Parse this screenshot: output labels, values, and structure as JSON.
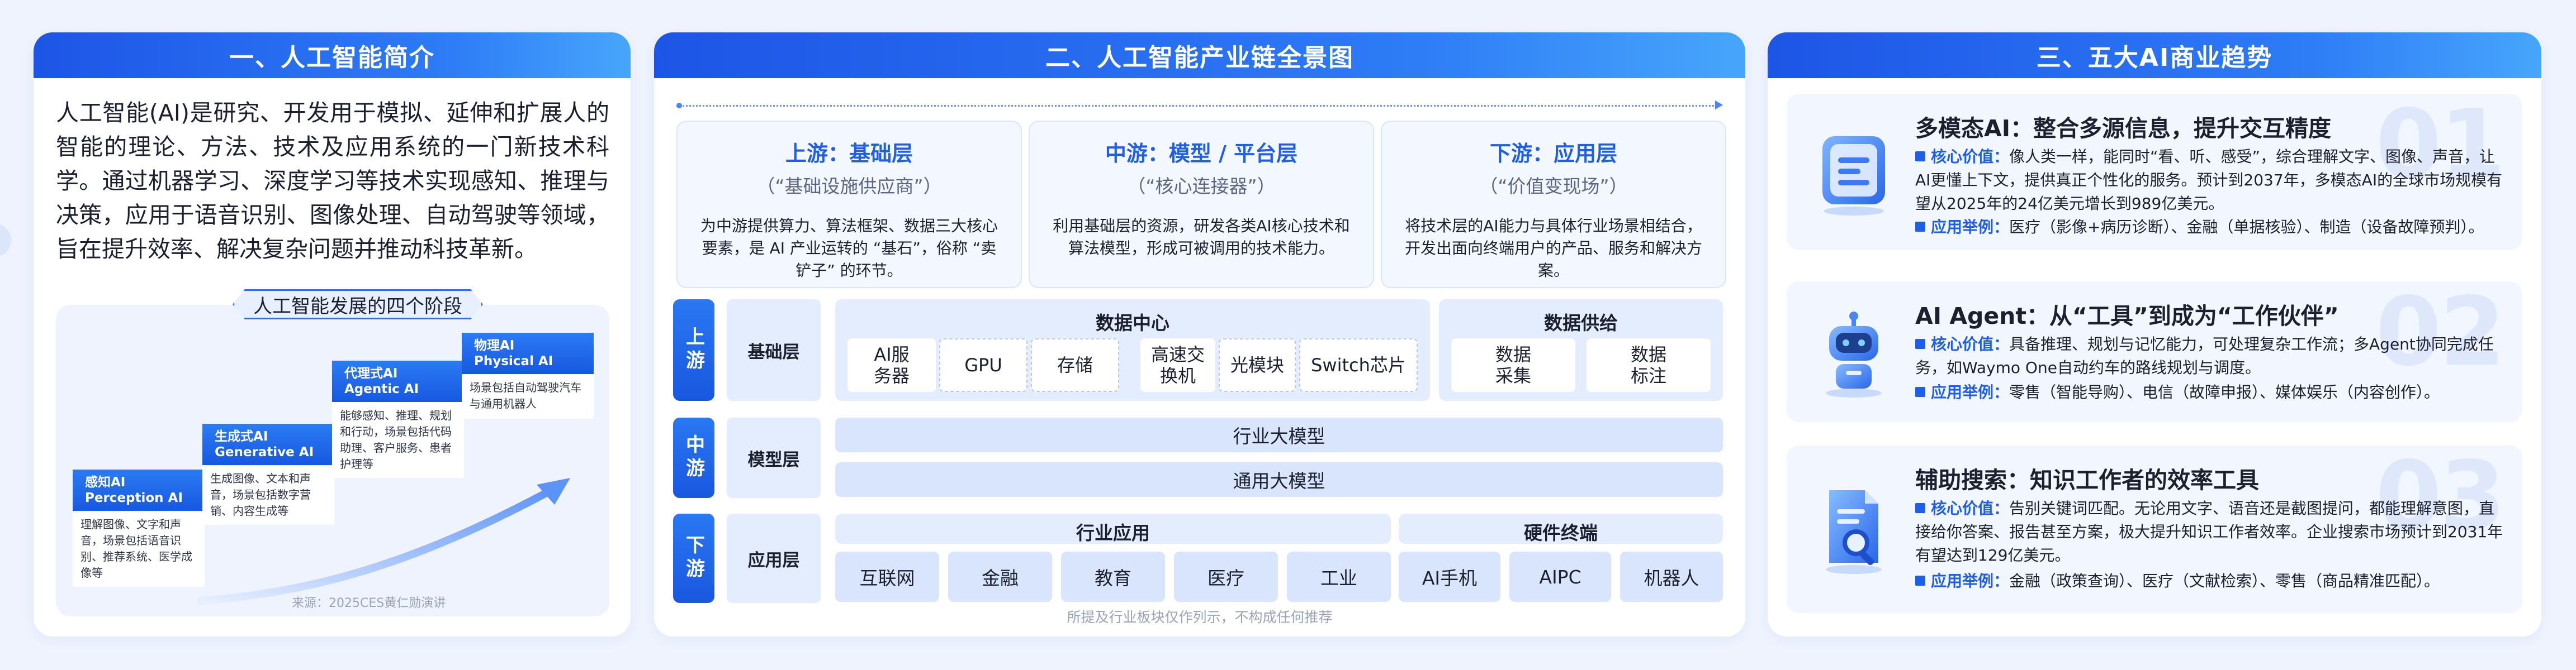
{
  "panel1": {
    "title": "一、人工智能简介",
    "intro": "人工智能(AI)是研究、开发用于模拟、延伸和扩展人的智能的理论、方法、技术及应用系统的一门新技术科学。通过机器学习、深度学习等技术实现感知、推理与决策，应用于语音识别、图像处理、自动驾驶等领域，旨在提升效率、解决复杂问题并推动科技革新。",
    "stages_title": "人工智能发展的四个阶段",
    "stages": [
      {
        "cn": "感知AI",
        "en": "Perception AI",
        "desc": "理解图像、文字和声音，场景包括语音识别、推荐系统、医学成像等"
      },
      {
        "cn": "生成式AI",
        "en": "Generative AI",
        "desc": "生成图像、文本和声音，场景包括数字营销、内容生成等"
      },
      {
        "cn": "代理式AI",
        "en": "Agentic AI",
        "desc": "能够感知、推理、规划和行动，场景包括代码助理、客户服务、患者护理等"
      },
      {
        "cn": "物理AI",
        "en": "Physical AI",
        "desc": "场景包括自动驾驶汽车与通用机器人"
      }
    ],
    "source": "来源：2025CES黄仁勋演讲"
  },
  "panel2": {
    "title": "二、人工智能产业链全景图",
    "overview": [
      {
        "title": "上游：基础层",
        "sub": "（“基础设施供应商”）",
        "desc": "为中游提供算力、算法框架、数据三大核心要素，是 AI 产业运转的 “基石”，俗称 “卖铲子” 的环节。"
      },
      {
        "title": "中游：模型 / 平台层",
        "sub": "（“核心连接器”）",
        "desc": "利用基础层的资源，研发各类AI核心技术和算法模型，形成可被调用的技术能力。"
      },
      {
        "title": "下游：应用层",
        "sub": "（“价值变现场”）",
        "desc": "将技术层的AI能力与具体行业场景相结合，开发出面向终端用户的产品、服务和解决方案。"
      }
    ],
    "tiers": {
      "up": {
        "label": "上游",
        "name": "基础层"
      },
      "mid": {
        "label": "中游",
        "name": "模型层"
      },
      "down": {
        "label": "下游",
        "name": "应用层"
      }
    },
    "datacenter": {
      "title": "数据中心",
      "items": [
        "AI服务器",
        "GPU",
        "存储",
        "高速交换机",
        "光模块",
        "Switch芯片"
      ]
    },
    "datasupply": {
      "title": "数据供给",
      "items": [
        "数据采集",
        "数据标注"
      ]
    },
    "models": [
      "行业大模型",
      "通用大模型"
    ],
    "industry": {
      "title": "行业应用",
      "items": [
        "互联网",
        "金融",
        "教育",
        "医疗",
        "工业"
      ]
    },
    "hardware": {
      "title": "硬件终端",
      "items": [
        "AI手机",
        "AIPC",
        "机器人"
      ]
    },
    "footnote": "所提及行业板块仅作列示，不构成任何推荐"
  },
  "panel3": {
    "title": "三、五大AI商业趋势",
    "trends": [
      {
        "num": "01",
        "title": "多模态AI：整合多源信息，提升交互精度",
        "value_label": "核心价值：",
        "value": "像人类一样，能同时“看、听、感受”，综合理解文字、图像、声音，让AI更懂上下文，提供真正个性化的服务。预计到2037年，多模态AI的全球市场规模有望从2025年的24亿美元增长到989亿美元。",
        "case_label": "应用举例：",
        "case": "医疗（影像+病历诊断）、金融（单据核验）、制造（设备故障预判）。"
      },
      {
        "num": "02",
        "title": "AI Agent：从“工具”到成为“工作伙伴”",
        "value_label": "核心价值：",
        "value": "具备推理、规划与记忆能力，可处理复杂工作流；多Agent协同完成任务，如Waymo One自动约车的路线规划与调度。",
        "case_label": "应用举例：",
        "case": "零售（智能导购）、电信（故障申报）、媒体娱乐（内容创作）。"
      },
      {
        "num": "03",
        "title": "辅助搜索：知识工作者的效率工具",
        "value_label": "核心价值：",
        "value": "告别关键词匹配。无论用文字、语音还是截图提问，都能理解意图，直接给你答案、报告甚至方案，极大提升知识工作者效率。企业搜索市场预计到2031年有望达到129亿美元。",
        "case_label": "应用举例：",
        "case": "金融（政策查询）、医疗（文献检索）、零售（商品精准匹配）。"
      }
    ]
  }
}
